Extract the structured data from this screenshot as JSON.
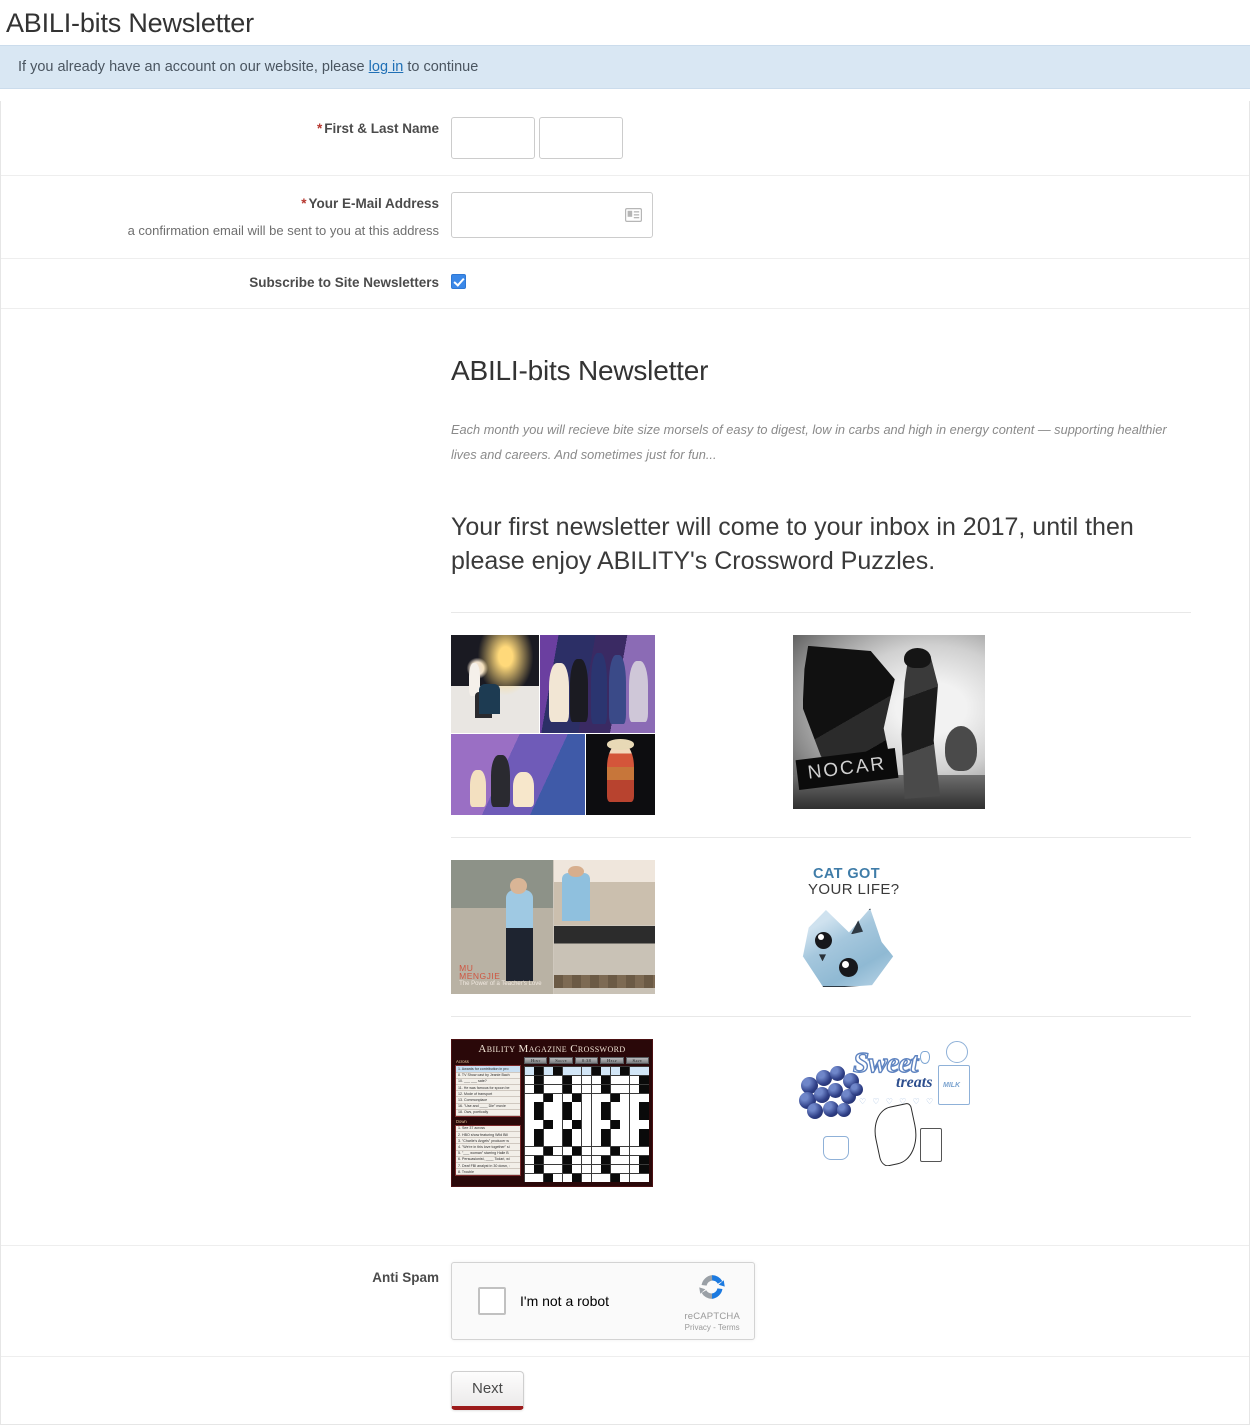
{
  "page": {
    "title": "ABILI-bits Newsletter"
  },
  "login_alert": {
    "text_before": "If you already have an account on our website, please ",
    "link_label": "log in",
    "text_after": " to continue"
  },
  "form": {
    "name_field": {
      "required_marker": "*",
      "label": "First & Last Name",
      "first_value": "",
      "last_value": ""
    },
    "email_field": {
      "required_marker": "*",
      "label": "Your E-Mail Address",
      "hint": "a confirmation email will be sent to you at this address",
      "value": "",
      "icon": "contact-card-icon"
    },
    "subscribe_field": {
      "label": "Subscribe to Site Newsletters",
      "checked": true
    },
    "anti_spam": {
      "label": "Anti Spam",
      "checkbox_label": "I'm not a robot",
      "brand": "reCAPTCHA",
      "privacy_label": "Privacy",
      "separator": "-",
      "terms_label": "Terms",
      "checked": false
    },
    "submit": {
      "label": "Next"
    }
  },
  "newsletter": {
    "title": "ABILI-bits Newsletter",
    "intro": "Each month you will recieve bite size morsels of easy to digest, low in carbs and high in energy content — supporting healthier lives and careers. And sometimes just for fun...",
    "headline": "Your first newsletter will come to your inbox in 2017, until then please enjoy ABILITY's Crossword Puzzles.",
    "thumbnails": [
      {
        "name": "fashion-awards-collage",
        "caption": ""
      },
      {
        "name": "nocar-motorcycle-photo",
        "caption": "NOCAR"
      },
      {
        "name": "mu-mengjie-teacher-collage",
        "caption_line1": "MU",
        "caption_line2": "MENGJIE",
        "caption_line3": "The Power of a Teacher's Love"
      },
      {
        "name": "cat-got-your-life-illustration",
        "caption_line1": "CAT GOT",
        "caption_line2": "YOUR LIFE?"
      },
      {
        "name": "ability-magazine-crossword",
        "caption": "Ability Magazine Crossword"
      },
      {
        "name": "sweet-treats-illustration",
        "caption_line1": "Sweet",
        "caption_line2": "treats"
      }
    ]
  },
  "crossword": {
    "title": "Ability Magazine Crossword",
    "buttons": [
      "Hint",
      "Solve",
      "0:38",
      "Help",
      "Save"
    ],
    "across_heading": "Across",
    "across_clues": [
      "1. Awards for contribution in pro",
      "8. TV Show cast by Jeanie Bach",
      "10. ___ ___ sate?",
      "11. He was famous for spoon be",
      "12. Mode of transport",
      "13. Commonplace",
      "16. \"Use and ____ Die\" movie",
      "18. Ows, poetically"
    ],
    "down_heading": "Down",
    "down_clues": [
      "1. See 37 across",
      "2. HBO show featuring Wild Bill",
      "3. \"Charlie's Angels\" producer w",
      "4. \"We're in this love together\" si",
      "5. \"___ woman\" starring Halle B",
      "6. Persuasionist, ____ Todari, wi",
      "7. Deaf FBI analyst in 30 down, :",
      "8. Trouble"
    ]
  },
  "sweet_treats": {
    "word1": "Sweet",
    "word2": "treats",
    "milk_label": "MILK",
    "hearts": "♡ ♡ ♡ ♡ ♡ ♡"
  },
  "colors": {
    "alert_bg": "#d9e7f3",
    "link": "#1f6fb5",
    "required": "#b6372f",
    "checkbox": "#3b88e8",
    "next_underline": "#9c1b1b",
    "recaptcha_blue": "#1c7ae0",
    "recaptcha_gray": "#9aa0a6"
  }
}
